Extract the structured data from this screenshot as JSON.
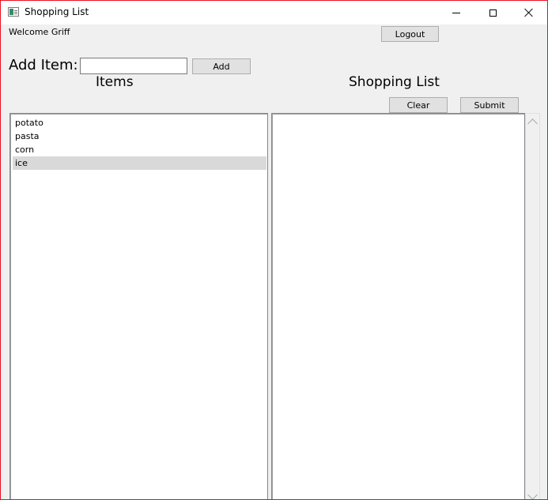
{
  "window": {
    "title": "Shopping List",
    "border_color": "#e81123",
    "icons": {
      "app": "window-app-icon",
      "minimize": "minimize-icon",
      "maximize": "maximize-icon",
      "close": "close-icon"
    }
  },
  "header": {
    "welcome_text": "Welcome Griff",
    "logout_label": "Logout"
  },
  "add_item": {
    "label": "Add Item:",
    "input_value": "",
    "button_label": "Add"
  },
  "items_panel": {
    "heading": "Items",
    "items": [
      {
        "label": "potato",
        "selected": false
      },
      {
        "label": "pasta",
        "selected": false
      },
      {
        "label": "corn",
        "selected": false
      },
      {
        "label": "ice",
        "selected": true
      }
    ]
  },
  "shopping_panel": {
    "heading": "Shopping List",
    "clear_label": "Clear",
    "submit_label": "Submit",
    "items": []
  },
  "colors": {
    "background": "#f0f0f0",
    "selection": "#d9d9d9",
    "button": "#e1e1e1"
  }
}
